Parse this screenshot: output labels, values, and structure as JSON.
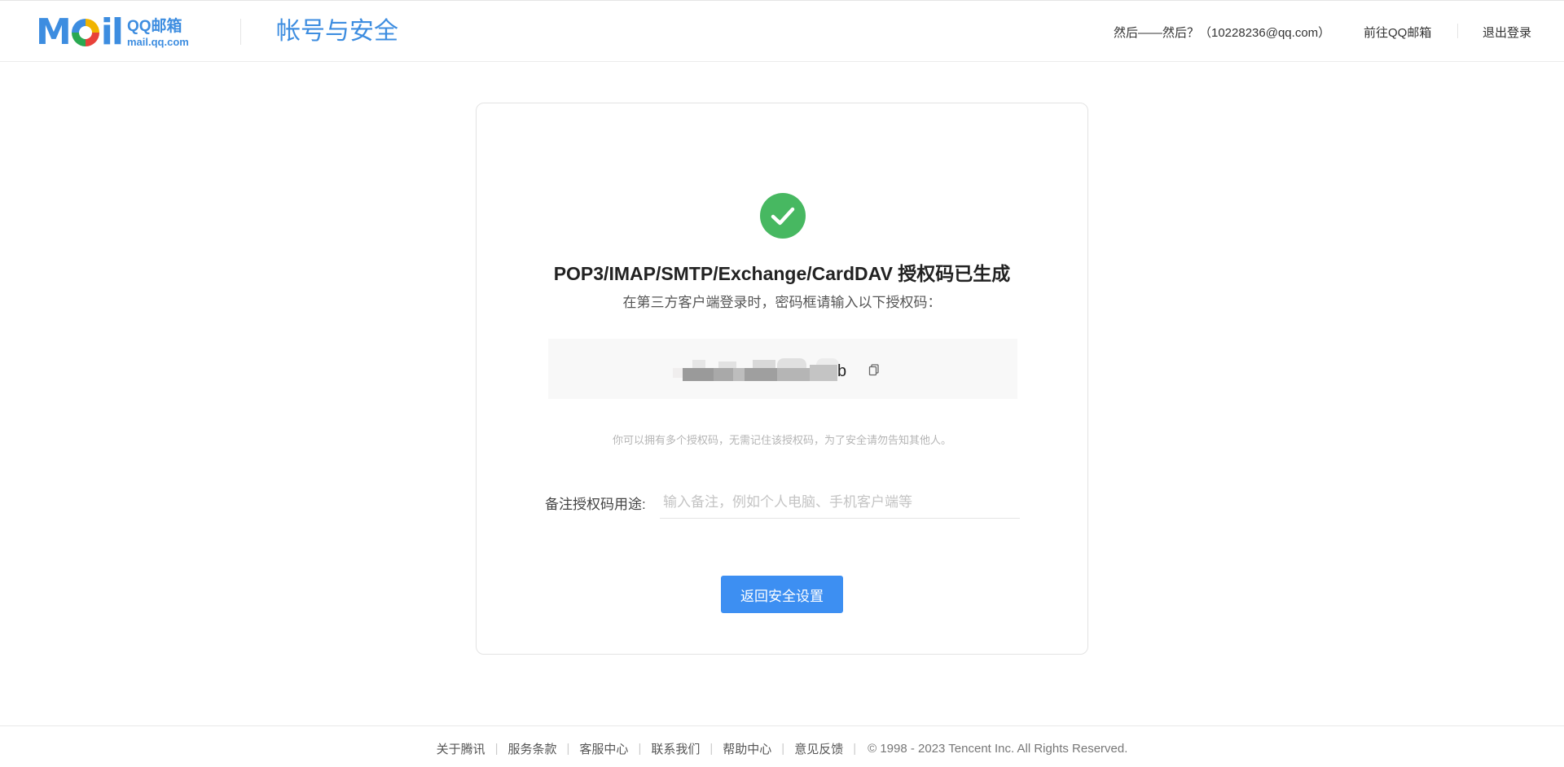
{
  "header": {
    "logo_mail": "Mail",
    "logo_qq": "QQ邮箱",
    "logo_domain": "mail.qq.com",
    "page_title": "帐号与安全",
    "user": "然后——然后？（10228236@qq.com）",
    "go_mail": "前往QQ邮箱",
    "logout": "退出登录"
  },
  "card": {
    "title": "POP3/IMAP/SMTP/Exchange/CardDAV 授权码已生成",
    "subtitle": "在第三方客户端登录时，密码框请输入以下授权码：",
    "code_visible_tail": "b",
    "hint": "你可以拥有多个授权码，无需记住该授权码，为了安全请勿告知其他人。",
    "note_label": "备注授权码用途:",
    "note_placeholder": "输入备注，例如个人电脑、手机客户端等",
    "note_value": "",
    "back_button": "返回安全设置"
  },
  "footer": {
    "links": [
      "关于腾讯",
      "服务条款",
      "客服中心",
      "联系我们",
      "帮助中心",
      "意见反馈"
    ],
    "copyright": "© 1998 - 2023 Tencent Inc. All Rights Reserved."
  },
  "colors": {
    "brand_blue": "#3d8de0",
    "success_green": "#47b861",
    "button_blue": "#3d8ff2"
  },
  "icons": {
    "success": "check-circle-icon",
    "copy": "copy-icon"
  }
}
